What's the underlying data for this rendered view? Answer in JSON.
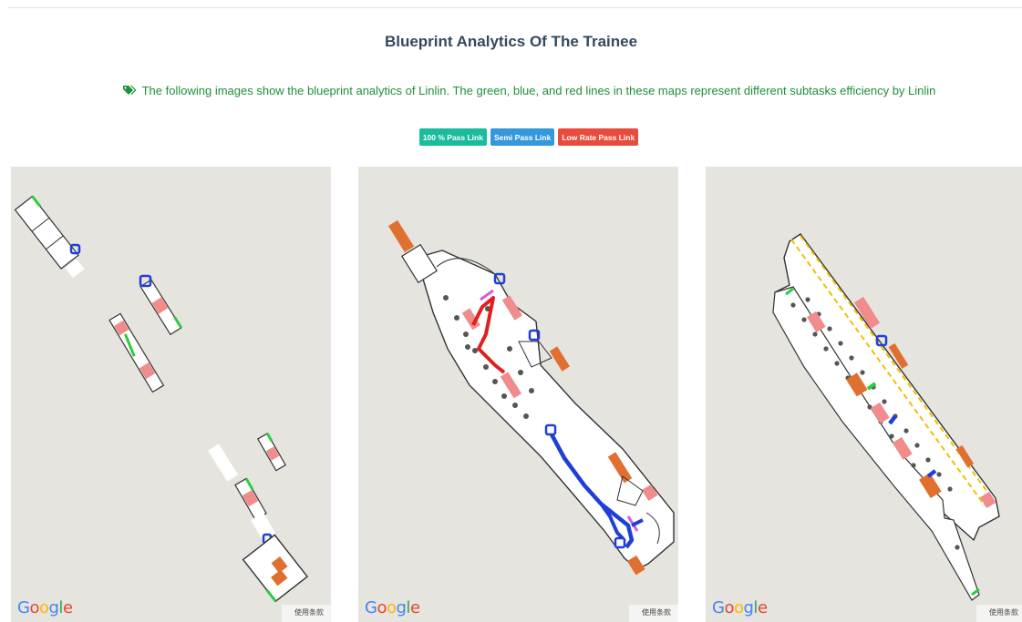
{
  "header": {
    "title": "Blueprint Analytics Of The Trainee",
    "description": "The following images show the blueprint analytics of Linlin. The green, blue, and red lines in these maps represent different subtasks efficiency by Linlin",
    "description_icon": "tag-icon"
  },
  "legend": {
    "items": [
      {
        "label": "100 % Pass Link",
        "color": "#1abc9c"
      },
      {
        "label": "Semi Pass Link",
        "color": "#3498db"
      },
      {
        "label": "Low Rate Pass Link",
        "color": "#e74c3c"
      }
    ]
  },
  "maps": [
    {
      "google": "Google",
      "terms": "使用条款"
    },
    {
      "google": "Google",
      "terms": "使用条款"
    },
    {
      "google": "Google",
      "terms": "使用条款"
    }
  ],
  "colors": {
    "map_background": "#e6e4df",
    "pass_green": "#2ecc40",
    "semi_blue": "#1f3fd6",
    "low_red": "#e83a3a",
    "furniture_orange": "#e07030",
    "pink": "#f2a0a0"
  }
}
